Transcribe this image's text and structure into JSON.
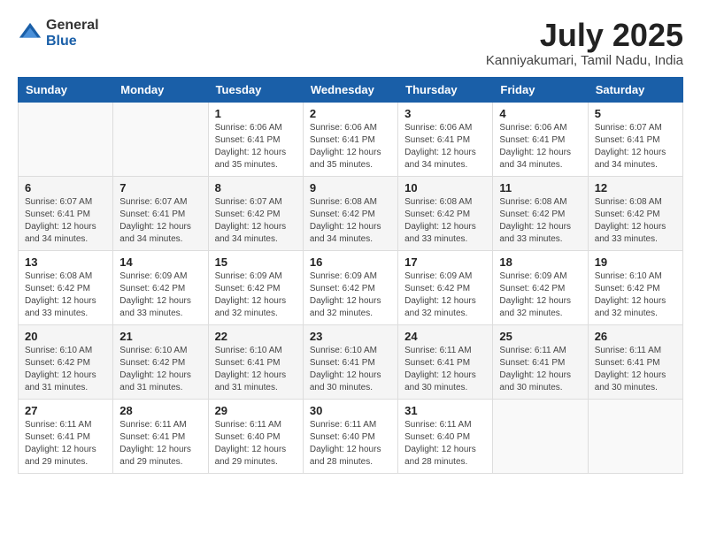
{
  "header": {
    "logo": {
      "general": "General",
      "blue": "Blue"
    },
    "title": "July 2025",
    "location": "Kanniyakumari, Tamil Nadu, India"
  },
  "weekdays": [
    "Sunday",
    "Monday",
    "Tuesday",
    "Wednesday",
    "Thursday",
    "Friday",
    "Saturday"
  ],
  "weeks": [
    [
      {
        "day": "",
        "info": ""
      },
      {
        "day": "",
        "info": ""
      },
      {
        "day": "1",
        "info": "Sunrise: 6:06 AM\nSunset: 6:41 PM\nDaylight: 12 hours\nand 35 minutes."
      },
      {
        "day": "2",
        "info": "Sunrise: 6:06 AM\nSunset: 6:41 PM\nDaylight: 12 hours\nand 35 minutes."
      },
      {
        "day": "3",
        "info": "Sunrise: 6:06 AM\nSunset: 6:41 PM\nDaylight: 12 hours\nand 34 minutes."
      },
      {
        "day": "4",
        "info": "Sunrise: 6:06 AM\nSunset: 6:41 PM\nDaylight: 12 hours\nand 34 minutes."
      },
      {
        "day": "5",
        "info": "Sunrise: 6:07 AM\nSunset: 6:41 PM\nDaylight: 12 hours\nand 34 minutes."
      }
    ],
    [
      {
        "day": "6",
        "info": "Sunrise: 6:07 AM\nSunset: 6:41 PM\nDaylight: 12 hours\nand 34 minutes."
      },
      {
        "day": "7",
        "info": "Sunrise: 6:07 AM\nSunset: 6:41 PM\nDaylight: 12 hours\nand 34 minutes."
      },
      {
        "day": "8",
        "info": "Sunrise: 6:07 AM\nSunset: 6:42 PM\nDaylight: 12 hours\nand 34 minutes."
      },
      {
        "day": "9",
        "info": "Sunrise: 6:08 AM\nSunset: 6:42 PM\nDaylight: 12 hours\nand 34 minutes."
      },
      {
        "day": "10",
        "info": "Sunrise: 6:08 AM\nSunset: 6:42 PM\nDaylight: 12 hours\nand 33 minutes."
      },
      {
        "day": "11",
        "info": "Sunrise: 6:08 AM\nSunset: 6:42 PM\nDaylight: 12 hours\nand 33 minutes."
      },
      {
        "day": "12",
        "info": "Sunrise: 6:08 AM\nSunset: 6:42 PM\nDaylight: 12 hours\nand 33 minutes."
      }
    ],
    [
      {
        "day": "13",
        "info": "Sunrise: 6:08 AM\nSunset: 6:42 PM\nDaylight: 12 hours\nand 33 minutes."
      },
      {
        "day": "14",
        "info": "Sunrise: 6:09 AM\nSunset: 6:42 PM\nDaylight: 12 hours\nand 33 minutes."
      },
      {
        "day": "15",
        "info": "Sunrise: 6:09 AM\nSunset: 6:42 PM\nDaylight: 12 hours\nand 32 minutes."
      },
      {
        "day": "16",
        "info": "Sunrise: 6:09 AM\nSunset: 6:42 PM\nDaylight: 12 hours\nand 32 minutes."
      },
      {
        "day": "17",
        "info": "Sunrise: 6:09 AM\nSunset: 6:42 PM\nDaylight: 12 hours\nand 32 minutes."
      },
      {
        "day": "18",
        "info": "Sunrise: 6:09 AM\nSunset: 6:42 PM\nDaylight: 12 hours\nand 32 minutes."
      },
      {
        "day": "19",
        "info": "Sunrise: 6:10 AM\nSunset: 6:42 PM\nDaylight: 12 hours\nand 32 minutes."
      }
    ],
    [
      {
        "day": "20",
        "info": "Sunrise: 6:10 AM\nSunset: 6:42 PM\nDaylight: 12 hours\nand 31 minutes."
      },
      {
        "day": "21",
        "info": "Sunrise: 6:10 AM\nSunset: 6:42 PM\nDaylight: 12 hours\nand 31 minutes."
      },
      {
        "day": "22",
        "info": "Sunrise: 6:10 AM\nSunset: 6:41 PM\nDaylight: 12 hours\nand 31 minutes."
      },
      {
        "day": "23",
        "info": "Sunrise: 6:10 AM\nSunset: 6:41 PM\nDaylight: 12 hours\nand 30 minutes."
      },
      {
        "day": "24",
        "info": "Sunrise: 6:11 AM\nSunset: 6:41 PM\nDaylight: 12 hours\nand 30 minutes."
      },
      {
        "day": "25",
        "info": "Sunrise: 6:11 AM\nSunset: 6:41 PM\nDaylight: 12 hours\nand 30 minutes."
      },
      {
        "day": "26",
        "info": "Sunrise: 6:11 AM\nSunset: 6:41 PM\nDaylight: 12 hours\nand 30 minutes."
      }
    ],
    [
      {
        "day": "27",
        "info": "Sunrise: 6:11 AM\nSunset: 6:41 PM\nDaylight: 12 hours\nand 29 minutes."
      },
      {
        "day": "28",
        "info": "Sunrise: 6:11 AM\nSunset: 6:41 PM\nDaylight: 12 hours\nand 29 minutes."
      },
      {
        "day": "29",
        "info": "Sunrise: 6:11 AM\nSunset: 6:40 PM\nDaylight: 12 hours\nand 29 minutes."
      },
      {
        "day": "30",
        "info": "Sunrise: 6:11 AM\nSunset: 6:40 PM\nDaylight: 12 hours\nand 28 minutes."
      },
      {
        "day": "31",
        "info": "Sunrise: 6:11 AM\nSunset: 6:40 PM\nDaylight: 12 hours\nand 28 minutes."
      },
      {
        "day": "",
        "info": ""
      },
      {
        "day": "",
        "info": ""
      }
    ]
  ]
}
